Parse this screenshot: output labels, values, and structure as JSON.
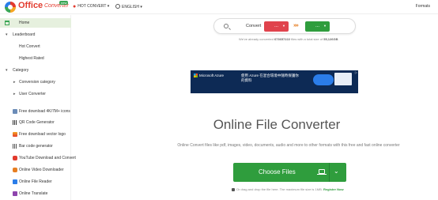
{
  "header": {
    "brand_main": "Office",
    "brand_sub": "Converter",
    "new_badge": "new",
    "hot_convert": "HOT CONVERT ▾",
    "language": "ENGLISH ▾",
    "formats": "Formats"
  },
  "sidebar": {
    "items": [
      {
        "label": "Home",
        "active": true
      },
      {
        "label": "Leaderboard"
      },
      {
        "label": "Hot Convert"
      },
      {
        "label": "Highest Rated"
      },
      {
        "label": "Category"
      },
      {
        "label": "Conversion category"
      },
      {
        "label": "User Converter"
      },
      {
        "label": "Free download 4K/7M+ icons"
      },
      {
        "label": "QR Code Generator"
      },
      {
        "label": "Free download vector logo"
      },
      {
        "label": "Bar code generator"
      },
      {
        "label": "YouTube Download and Convert"
      },
      {
        "label": "Online Video Downloader"
      },
      {
        "label": "Online File Reader"
      },
      {
        "label": "Online Translate"
      }
    ]
  },
  "converter": {
    "label": "Convert",
    "from": "...",
    "to": "...",
    "arrows": "»»",
    "stats_prefix": "We've already converted ",
    "stats_count": "673657222",
    "stats_mid": " files with a total size of ",
    "stats_size": "55,126GB"
  },
  "ad": {
    "brand": "Microsoft Azure",
    "text": "使用 Azure 在混合環境中隨時保護你的資料"
  },
  "main": {
    "title": "Online File Converter",
    "subtitle": "Online Convert files like pdf, images, video, documents, audio and more to other formats with this free and fast online converter",
    "choose_label": "Choose Files",
    "drop_text": "Or drag and drop the file here. The maximum file size is 1MB.",
    "register": "Register Now"
  },
  "colors": {
    "accent_green": "#2f9d3d",
    "accent_red": "#e0434d",
    "brand_red": "#e23b2e"
  }
}
